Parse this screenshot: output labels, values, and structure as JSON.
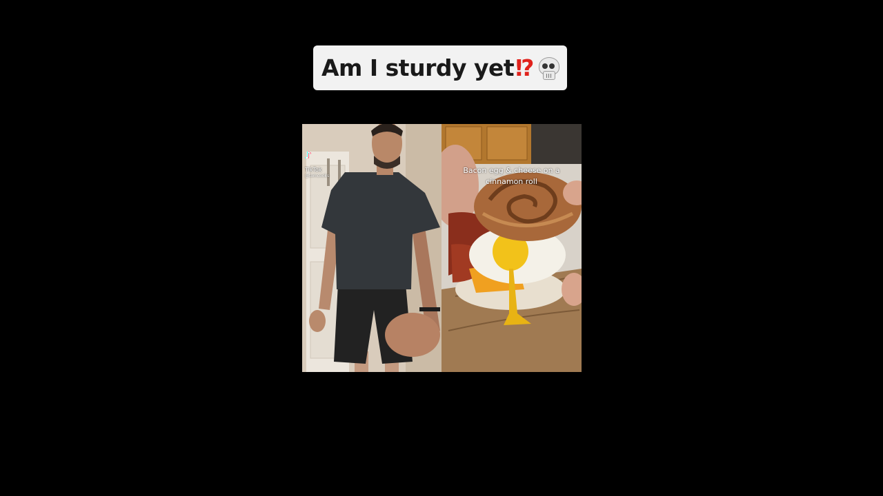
{
  "caption": {
    "text": "Am I sturdy yet",
    "punctuation": "⁉",
    "emoji_icon": "skull-icon",
    "punctuation_color": "#e0221c"
  },
  "video": {
    "left_panel": {
      "watermark": "TikTok",
      "username": "@tomcooks"
    },
    "right_panel": {
      "overlay_text": "Bacon egg & cheese on a cinnamon roll"
    }
  }
}
